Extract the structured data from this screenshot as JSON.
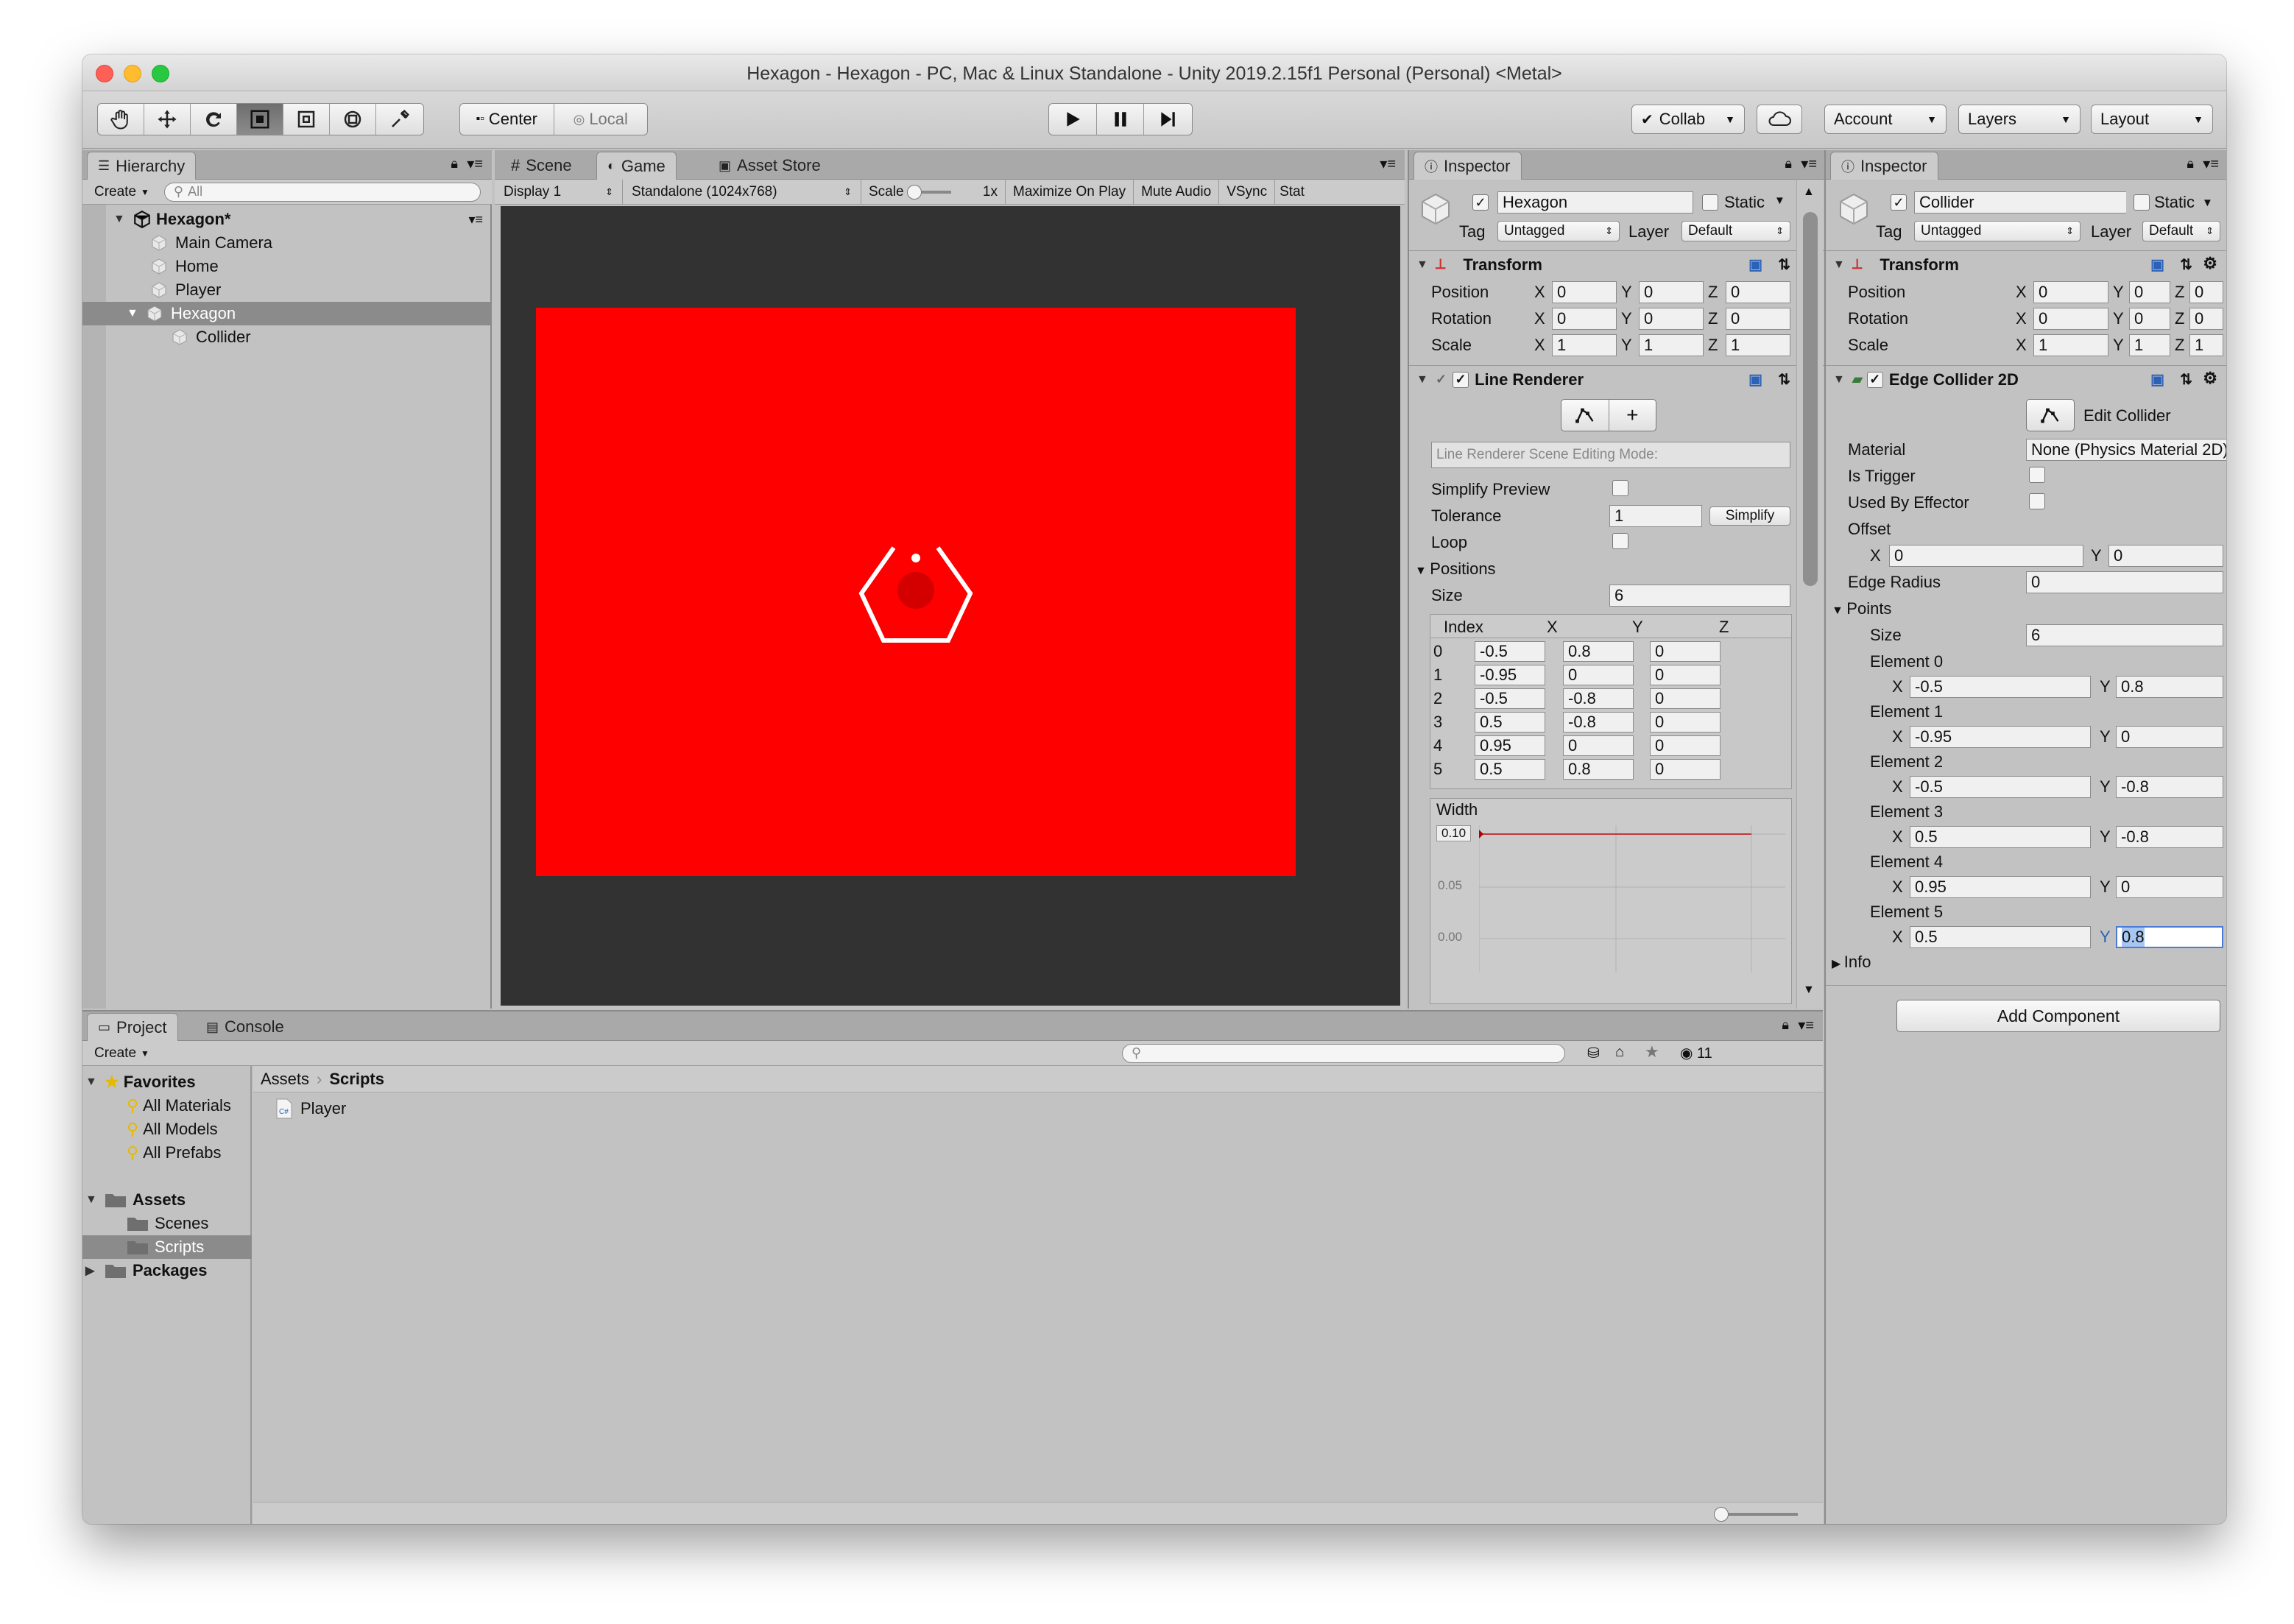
{
  "window": {
    "title": "Hexagon - Hexagon - PC, Mac & Linux Standalone - Unity 2019.2.15f1 Personal (Personal) <Metal>"
  },
  "toolbar": {
    "tools": [
      "hand-tool",
      "move-tool",
      "rotate-tool",
      "scale-tool",
      "rect-tool",
      "transform-tool",
      "custom-tool"
    ],
    "pivot": "Center",
    "space": "Local",
    "collab": "Collab",
    "account": "Account",
    "layers": "Layers",
    "layout": "Layout"
  },
  "hierarchy": {
    "tab": "Hierarchy",
    "create": "Create",
    "search_placeholder": "All",
    "scene": "Hexagon*",
    "items": [
      {
        "label": "Main Camera"
      },
      {
        "label": "Home"
      },
      {
        "label": "Player"
      },
      {
        "label": "Hexagon"
      },
      {
        "label": "Collider"
      }
    ]
  },
  "center_tabs": {
    "scene": "Scene",
    "game": "Game",
    "asset_store": "Asset Store"
  },
  "game": {
    "display": "Display 1",
    "resolution": "Standalone (1024x768)",
    "scale_label": "Scale",
    "scale_value": "1x",
    "maximize": "Maximize On Play",
    "mute": "Mute Audio",
    "vsync": "VSync",
    "stats": "Stat",
    "background_color": "#ff0000"
  },
  "inspector1": {
    "tab": "Inspector",
    "object_name": "Hexagon",
    "static": "Static",
    "tag_label": "Tag",
    "tag": "Untagged",
    "layer_label": "Layer",
    "layer": "Default",
    "transform": {
      "title": "Transform",
      "position_label": "Position",
      "position": [
        "0",
        "0",
        "0"
      ],
      "rotation_label": "Rotation",
      "rotation": [
        "0",
        "0",
        "0"
      ],
      "scale_label": "Scale",
      "scale": [
        "1",
        "1",
        "1"
      ]
    },
    "line_renderer": {
      "title": "Line Renderer",
      "mode_placeholder": "Line Renderer Scene Editing Mode:",
      "simplify_preview": "Simplify Preview",
      "tolerance_label": "Tolerance",
      "tolerance": "1",
      "simplify_button": "Simplify",
      "loop": "Loop",
      "positions": "Positions",
      "size_label": "Size",
      "size": "6",
      "columns": [
        "Index",
        "X",
        "Y",
        "Z"
      ],
      "rows": [
        [
          "0",
          "-0.5",
          "0.8",
          "0"
        ],
        [
          "1",
          "-0.95",
          "0",
          "0"
        ],
        [
          "2",
          "-0.5",
          "-0.8",
          "0"
        ],
        [
          "3",
          "0.5",
          "-0.8",
          "0"
        ],
        [
          "4",
          "0.95",
          "0",
          "0"
        ],
        [
          "5",
          "0.5",
          "0.8",
          "0"
        ]
      ],
      "width_label": "Width",
      "width_ticks": [
        "0.10",
        "0.05",
        "0.00"
      ]
    }
  },
  "inspector2": {
    "tab": "Inspector",
    "object_name": "Collider",
    "static": "Static",
    "tag_label": "Tag",
    "tag": "Untagged",
    "layer_label": "Layer",
    "layer": "Default",
    "transform": {
      "title": "Transform",
      "position_label": "Position",
      "position": [
        "0",
        "0",
        "0"
      ],
      "rotation_label": "Rotation",
      "rotation": [
        "0",
        "0",
        "0"
      ],
      "scale_label": "Scale",
      "scale": [
        "1",
        "1",
        "1"
      ]
    },
    "edge_collider": {
      "title": "Edge Collider 2D",
      "edit_collider": "Edit Collider",
      "material_label": "Material",
      "material": "None (Physics Material 2D)",
      "is_trigger": "Is Trigger",
      "used_by_effector": "Used By Effector",
      "offset_label": "Offset",
      "offset": [
        "0",
        "0"
      ],
      "edge_radius_label": "Edge Radius",
      "edge_radius": "0",
      "points_label": "Points",
      "size_label": "Size",
      "size": "6",
      "elements": [
        {
          "label": "Element 0",
          "x": "-0.5",
          "y": "0.8"
        },
        {
          "label": "Element 1",
          "x": "-0.95",
          "y": "0"
        },
        {
          "label": "Element 2",
          "x": "-0.5",
          "y": "-0.8"
        },
        {
          "label": "Element 3",
          "x": "0.5",
          "y": "-0.8"
        },
        {
          "label": "Element 4",
          "x": "0.95",
          "y": "0"
        },
        {
          "label": "Element 5",
          "x": "0.5",
          "y": "0.8"
        }
      ],
      "info": "Info",
      "add_component": "Add Component"
    }
  },
  "project": {
    "tab_project": "Project",
    "tab_console": "Console",
    "create": "Create",
    "hidden_count": "11",
    "favorites": "Favorites",
    "fav_items": [
      "All Materials",
      "All Models",
      "All Prefabs"
    ],
    "assets": "Assets",
    "asset_folders": [
      "Scenes",
      "Scripts"
    ],
    "packages": "Packages",
    "breadcrumb": [
      "Assets",
      "Scripts"
    ],
    "files": [
      "Player"
    ]
  }
}
